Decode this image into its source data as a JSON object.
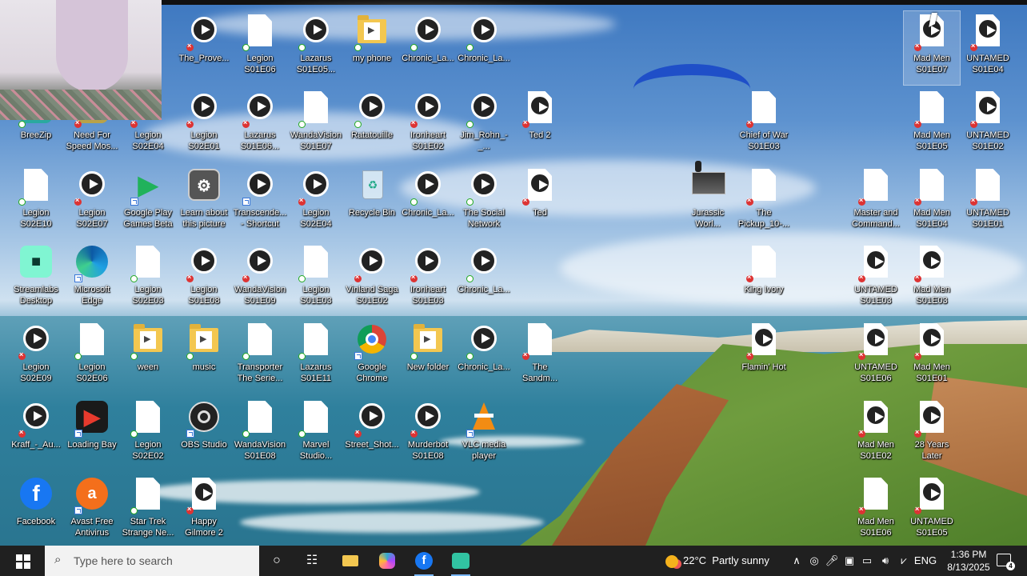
{
  "desktop": {
    "icons": [
      {
        "label": "The_Prove...",
        "type": "video",
        "badge": "x"
      },
      {
        "label": "Legion\nS01E06",
        "type": "doc",
        "badge": "ok"
      },
      {
        "label": "Lazarus\nS01E05...",
        "type": "video",
        "badge": "ok"
      },
      {
        "label": "my phone",
        "type": "folder",
        "badge": "ok"
      },
      {
        "label": "Chronic_La...",
        "type": "video",
        "badge": "ok"
      },
      {
        "label": "Chronic_La...",
        "type": "video",
        "badge": "ok"
      },
      {
        "label": "Mad Men\nS01E07",
        "type": "video-white",
        "badge": "x"
      },
      {
        "label": "UNTAMED\nS01E04",
        "type": "video-white",
        "badge": "x"
      },
      {
        "label": "BreeZip",
        "type": "app-breezip",
        "badge": "ok"
      },
      {
        "label": "Need For\nSpeed Mos...",
        "type": "app-nfs",
        "badge": "x"
      },
      {
        "label": "Legion\nS02E04",
        "type": "video",
        "badge": "x"
      },
      {
        "label": "Legion\nS02E01",
        "type": "video",
        "badge": "x"
      },
      {
        "label": "Lazarus\nS01E06...",
        "type": "video",
        "badge": "x"
      },
      {
        "label": "WandaVision\nS01E07",
        "type": "doc",
        "badge": "ok"
      },
      {
        "label": "Ratatouille",
        "type": "video",
        "badge": "ok"
      },
      {
        "label": "Ironheart\nS01E02",
        "type": "video",
        "badge": "x"
      },
      {
        "label": "Jim_Rohn_-_...",
        "type": "video",
        "badge": "ok"
      },
      {
        "label": "Ted 2",
        "type": "video-white",
        "badge": "x"
      },
      {
        "label": "Chief of War\nS01E03",
        "type": "doc",
        "badge": "x"
      },
      {
        "label": "Mad Men\nS01E05",
        "type": "doc",
        "badge": "x"
      },
      {
        "label": "UNTAMED\nS01E02",
        "type": "video-white",
        "badge": "x"
      },
      {
        "label": "Legion\nS02E10",
        "type": "doc",
        "badge": "ok"
      },
      {
        "label": "Legion\nS02E07",
        "type": "video",
        "badge": "x"
      },
      {
        "label": "Google Play\nGames Beta",
        "type": "app-gplay",
        "badge": "shortcut"
      },
      {
        "label": "Learn about\nthis picture",
        "type": "app-learn",
        "badge": "none"
      },
      {
        "label": "Transcende...\n- Shortcut",
        "type": "video",
        "badge": "shortcut"
      },
      {
        "label": "Legion\nS02E04",
        "type": "video",
        "badge": "x"
      },
      {
        "label": "Recycle Bin",
        "type": "app-bin",
        "badge": "none"
      },
      {
        "label": "Chronic_La...",
        "type": "video",
        "badge": "ok"
      },
      {
        "label": "The Social\nNetwork",
        "type": "video",
        "badge": "ok"
      },
      {
        "label": "Ted",
        "type": "video-white",
        "badge": "x"
      },
      {
        "label": "Jurassic\nWorl...",
        "type": "thumb",
        "badge": "none"
      },
      {
        "label": "The\nPickup_10-...",
        "type": "doc",
        "badge": "x"
      },
      {
        "label": "Master and\nCommand...",
        "type": "doc",
        "badge": "x"
      },
      {
        "label": "Mad Men\nS01E04",
        "type": "doc",
        "badge": "x"
      },
      {
        "label": "UNTAMED\nS01E01",
        "type": "doc",
        "badge": "x"
      },
      {
        "label": "Streamlabs\nDesktop",
        "type": "app-streamlabs",
        "badge": "none"
      },
      {
        "label": "Microsoft\nEdge",
        "type": "app-edge",
        "badge": "shortcut"
      },
      {
        "label": "Legion\nS02E03",
        "type": "doc",
        "badge": "ok"
      },
      {
        "label": "Legion\nS01E08",
        "type": "video",
        "badge": "x"
      },
      {
        "label": "WandaVision\nS01E09",
        "type": "video",
        "badge": "x"
      },
      {
        "label": "Legion\nS01E03",
        "type": "doc",
        "badge": "ok"
      },
      {
        "label": "Vinland Saga\nS01E02",
        "type": "video",
        "badge": "x"
      },
      {
        "label": "Ironheart\nS01E03",
        "type": "video",
        "badge": "x"
      },
      {
        "label": "Chronic_La...",
        "type": "video",
        "badge": "ok"
      },
      {
        "label": "King Ivory",
        "type": "doc",
        "badge": "x"
      },
      {
        "label": "UNTAMED\nS01E03",
        "type": "video-white",
        "badge": "x"
      },
      {
        "label": "Mad Men\nS01E03",
        "type": "video-white",
        "badge": "x"
      },
      {
        "label": "Legion\nS02E09",
        "type": "video",
        "badge": "x"
      },
      {
        "label": "Legion\nS02E06",
        "type": "doc",
        "badge": "ok"
      },
      {
        "label": "ween",
        "type": "folder",
        "badge": "ok"
      },
      {
        "label": "music",
        "type": "folder",
        "badge": "ok"
      },
      {
        "label": "Transporter\nThe Serie...",
        "type": "doc",
        "badge": "ok"
      },
      {
        "label": "Lazarus\nS01E11",
        "type": "doc",
        "badge": "ok"
      },
      {
        "label": "Google\nChrome",
        "type": "app-chrome",
        "badge": "shortcut"
      },
      {
        "label": "New folder",
        "type": "folder",
        "badge": "ok"
      },
      {
        "label": "Chronic_La...",
        "type": "video",
        "badge": "ok"
      },
      {
        "label": "The\nSandm...",
        "type": "doc",
        "badge": "x"
      },
      {
        "label": "Flamin' Hot",
        "type": "video-white",
        "badge": "x"
      },
      {
        "label": "UNTAMED\nS01E06",
        "type": "video-white",
        "badge": "x"
      },
      {
        "label": "Mad Men\nS01E01",
        "type": "video-white",
        "badge": "x"
      },
      {
        "label": "Kraff_-_Au...",
        "type": "video",
        "badge": "x"
      },
      {
        "label": "Loading Bay",
        "type": "app-loadingbay",
        "badge": "shortcut"
      },
      {
        "label": "Legion\nS02E02",
        "type": "doc",
        "badge": "ok"
      },
      {
        "label": "OBS Studio",
        "type": "app-obs",
        "badge": "shortcut"
      },
      {
        "label": "WandaVision\nS01E08",
        "type": "doc",
        "badge": "ok"
      },
      {
        "label": "Marvel\nStudio...",
        "type": "doc",
        "badge": "ok"
      },
      {
        "label": "Street_Shot...",
        "type": "video",
        "badge": "x"
      },
      {
        "label": "Murderbot\nS01E08",
        "type": "video",
        "badge": "x"
      },
      {
        "label": "VLC media\nplayer",
        "type": "app-vlc",
        "badge": "shortcut"
      },
      {
        "label": "Mad Men\nS01E02",
        "type": "video-white",
        "badge": "x"
      },
      {
        "label": "28 Years Later",
        "type": "video-white",
        "badge": "x"
      },
      {
        "label": "Facebook",
        "type": "app-facebook",
        "badge": "none"
      },
      {
        "label": "Avast Free\nAntivirus",
        "type": "app-avast",
        "badge": "shortcut"
      },
      {
        "label": "Star Trek\nStrange Ne...",
        "type": "doc",
        "badge": "ok"
      },
      {
        "label": "Happy\nGilmore 2",
        "type": "video-white",
        "badge": "x"
      },
      {
        "label": "Mad Men\nS01E06",
        "type": "doc",
        "badge": "x"
      },
      {
        "label": "UNTAMED\nS01E05",
        "type": "video-white",
        "badge": "x"
      }
    ]
  },
  "taskbar": {
    "search_placeholder": "Type here to search",
    "weather_temp": "22°C",
    "weather_text": "Partly sunny",
    "language": "ENG",
    "time": "1:36 PM",
    "date": "8/13/2025",
    "notification_count": "4",
    "colors": {
      "bar": "#202020",
      "search": "#f2f2f2",
      "accent": "#7ab8ff"
    }
  }
}
